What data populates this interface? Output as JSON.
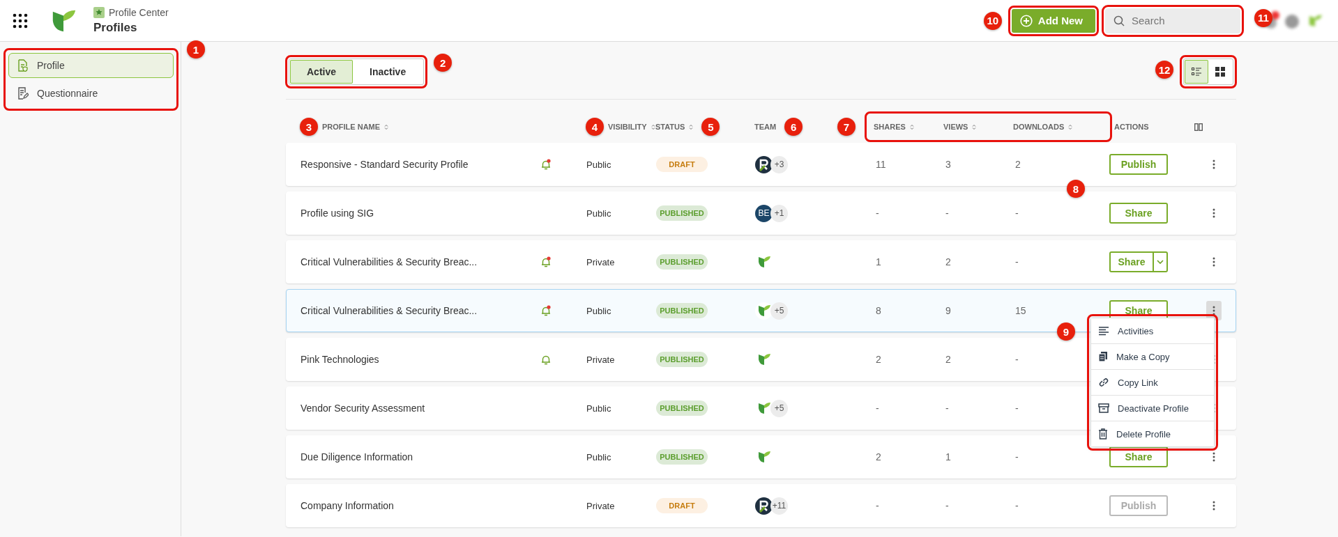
{
  "app": {
    "product": "Profile Center",
    "page_title": "Profiles"
  },
  "toolbar": {
    "add_button": {
      "label": "Add New",
      "callout": "10",
      "outlined": true
    },
    "search": {
      "placeholder": "Search",
      "outlined": true
    },
    "account_callout": "11"
  },
  "sidebar": {
    "callout": "1",
    "outlined": true,
    "items": [
      {
        "label": "Profile",
        "selected": true
      },
      {
        "label": "Questionnaire",
        "selected": false
      }
    ]
  },
  "tabs": {
    "callout": "2",
    "outlined": true,
    "items": [
      {
        "label": "Active",
        "selected": true
      },
      {
        "label": "Inactive",
        "selected": false
      }
    ]
  },
  "view_toggle": {
    "callout": "12",
    "outlined": true,
    "items": [
      {
        "kind": "list",
        "selected": true
      },
      {
        "kind": "grid",
        "selected": false
      }
    ]
  },
  "table": {
    "columns": [
      {
        "label": "PROFILE NAME",
        "sortable": true,
        "callout": "3"
      },
      {
        "label": "VISIBILITY",
        "sortable": true,
        "callout": "4"
      },
      {
        "label": "STATUS",
        "sortable": true,
        "callout": "5"
      },
      {
        "label": "TEAM",
        "sortable": false,
        "callout": "6"
      }
    ],
    "stat_columns": {
      "callout": "7",
      "outlined": true,
      "columns": [
        {
          "label": "SHARES",
          "sortable": true
        },
        {
          "label": "VIEWS",
          "sortable": true
        },
        {
          "label": "DOWNLOADS",
          "sortable": true
        }
      ]
    },
    "actions_column": {
      "label": "ACTIONS",
      "sortable": false
    },
    "rows": [
      {
        "name": "Responsive - Standard Security Profile",
        "bell": true,
        "unread": true,
        "visibility": "Public",
        "status": {
          "label": "DRAFT",
          "draft": true
        },
        "team": [
          {
            "kind": "r-mark"
          }
        ],
        "team_more": "+3",
        "shares": "11",
        "views": "3",
        "downloads": "2",
        "action": {
          "label": "Publish",
          "kind": "button",
          "disabled": false
        },
        "highlighted": false,
        "menu_open": false,
        "callout": "8"
      },
      {
        "name": "Profile using SIG",
        "bell": false,
        "visibility": "Public",
        "status": {
          "label": "PUBLISHED",
          "draft": false
        },
        "team": [
          {
            "kind": "initials",
            "initials": "BE"
          }
        ],
        "team_more": "+1",
        "shares": "-",
        "views": "-",
        "downloads": "-",
        "action": {
          "label": "Share",
          "kind": "button",
          "disabled": false
        },
        "highlighted": false,
        "menu_open": false
      },
      {
        "name": "Critical Vulnerabilities & Security Breac...",
        "bell": true,
        "unread": true,
        "visibility": "Private",
        "status": {
          "label": "PUBLISHED",
          "draft": false
        },
        "team": [
          {
            "kind": "leaf"
          }
        ],
        "shares": "1",
        "views": "2",
        "downloads": "-",
        "action": {
          "label": "Share",
          "kind": "split",
          "disabled": false
        },
        "highlighted": false,
        "menu_open": false
      },
      {
        "name": "Critical Vulnerabilities & Security Breac...",
        "bell": true,
        "unread": true,
        "visibility": "Public",
        "status": {
          "label": "PUBLISHED",
          "draft": false
        },
        "team": [
          {
            "kind": "leaf"
          }
        ],
        "team_more": "+5",
        "shares": "8",
        "views": "9",
        "downloads": "15",
        "action": {
          "label": "Share",
          "kind": "button",
          "disabled": false
        },
        "highlighted": true,
        "menu_open": true,
        "menu": {
          "callout": "9",
          "outlined": true,
          "items": [
            {
              "label": "Activities"
            },
            {
              "label": "Make a Copy"
            },
            {
              "label": "Copy Link"
            },
            {
              "label": "Deactivate Profile"
            },
            {
              "label": "Delete Profile"
            }
          ]
        }
      },
      {
        "name": "Pink Technologies",
        "bell": true,
        "unread": false,
        "visibility": "Private",
        "status": {
          "label": "PUBLISHED",
          "draft": false
        },
        "team": [
          {
            "kind": "leaf"
          }
        ],
        "shares": "2",
        "views": "2",
        "downloads": "-",
        "highlighted": false,
        "menu_open": false
      },
      {
        "name": "Vendor Security Assessment",
        "bell": false,
        "visibility": "Public",
        "status": {
          "label": "PUBLISHED",
          "draft": false
        },
        "team": [
          {
            "kind": "leaf"
          }
        ],
        "team_more": "+5",
        "shares": "-",
        "views": "-",
        "downloads": "-",
        "highlighted": false,
        "menu_open": false
      },
      {
        "name": "Due Diligence Information",
        "bell": false,
        "visibility": "Public",
        "status": {
          "label": "PUBLISHED",
          "draft": false
        },
        "team": [
          {
            "kind": "leaf"
          }
        ],
        "shares": "2",
        "views": "1",
        "downloads": "-",
        "action": {
          "label": "Share",
          "kind": "button",
          "disabled": false
        },
        "highlighted": false,
        "menu_open": false
      },
      {
        "name": "Company Information",
        "bell": false,
        "visibility": "Private",
        "status": {
          "label": "DRAFT",
          "draft": true
        },
        "team": [
          {
            "kind": "r-mark"
          }
        ],
        "team_more": "+11",
        "shares": "-",
        "views": "-",
        "downloads": "-",
        "action": {
          "label": "Publish",
          "kind": "button",
          "disabled": true
        },
        "highlighted": false,
        "menu_open": false
      }
    ]
  }
}
